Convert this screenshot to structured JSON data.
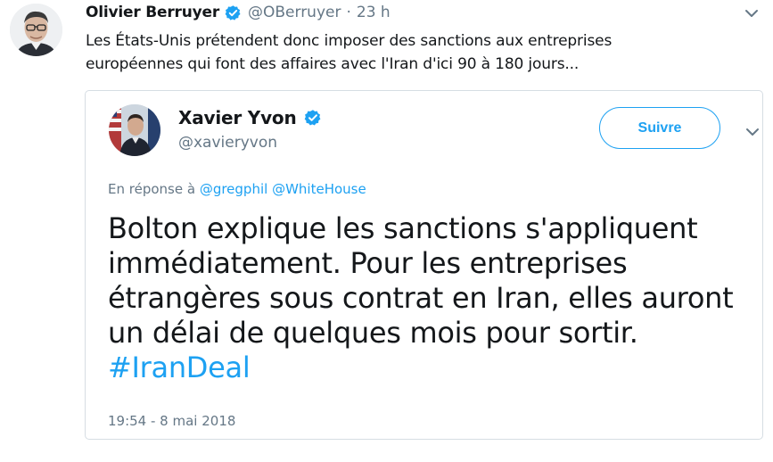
{
  "colors": {
    "link": "#1da1f2",
    "secondary_text": "#657786",
    "primary_text": "#14171a",
    "verified_badge": "#1da1f2",
    "card_border": "#d6dde3"
  },
  "tweet": {
    "author_name": "Olivier Berruyer",
    "author_handle": "@OBerruyer",
    "separator": "·",
    "time": "23 h",
    "verified_icon": "verified-badge-icon",
    "menu_icon": "chevron-down-icon",
    "text_lines": [
      "Les États-Unis prétendent donc imposer des sanctions aux entreprises",
      "européennes qui font des affaires avec l'Iran d'ici 90 à 180 jours..."
    ]
  },
  "quoted": {
    "author_name": "Xavier Yvon",
    "author_handle": "@xavieryvon",
    "follow_label": "Suivre",
    "reply_prefix": "En réponse à",
    "reply_mentions": [
      "@gregphil",
      "@WhiteHouse"
    ],
    "text_lines": [
      "Bolton explique les sanctions s'appliquent",
      "immédiatement. Pour les entreprises",
      "étrangères sous contrat en Iran, elles auront",
      "un délai de quelques mois pour sortir."
    ],
    "hashtag": "#IranDeal",
    "timestamp": "19:54 - 8 mai 2018"
  }
}
